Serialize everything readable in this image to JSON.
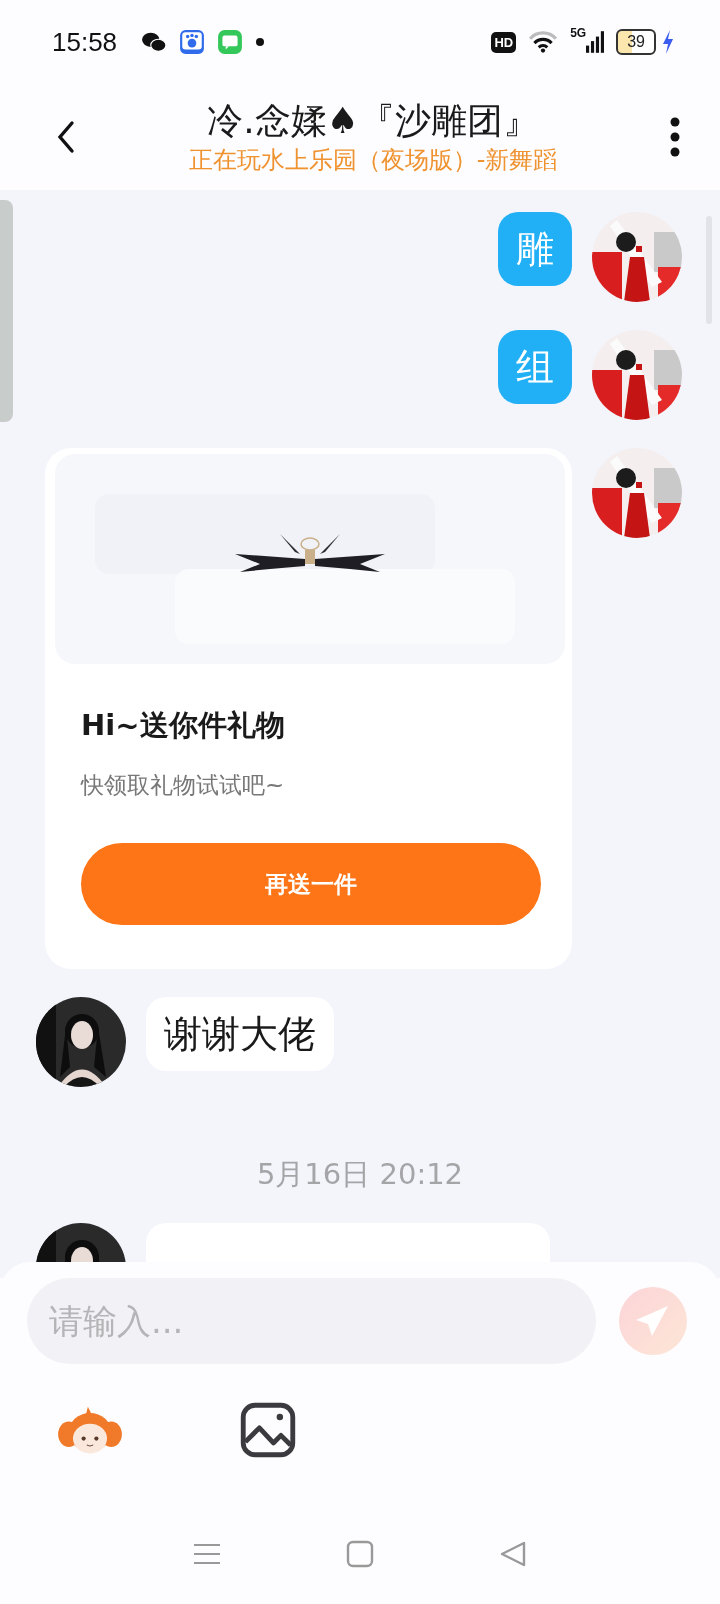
{
  "status_bar": {
    "time": "15:58",
    "hd": "HD",
    "network": "5G",
    "battery": "39"
  },
  "header": {
    "title": "冷.念媃♠『沙雕团』",
    "subtitle": "正在玩水上乐园（夜场版）-新舞蹈"
  },
  "messages": [
    {
      "kind": "text",
      "outgoing": true,
      "text": "雕"
    },
    {
      "kind": "text",
      "outgoing": true,
      "text": "组"
    },
    {
      "kind": "gift",
      "outgoing": true,
      "title": "Hi~送你件礼物",
      "subtitle": "快领取礼物试试吧~",
      "button": "再送一件"
    },
    {
      "kind": "text",
      "outgoing": false,
      "text": "谢谢大佬"
    },
    {
      "kind": "time",
      "text": "5月16日 20:12"
    },
    {
      "kind": "text",
      "outgoing": false
    }
  ],
  "composer": {
    "placeholder": "请输入..."
  }
}
